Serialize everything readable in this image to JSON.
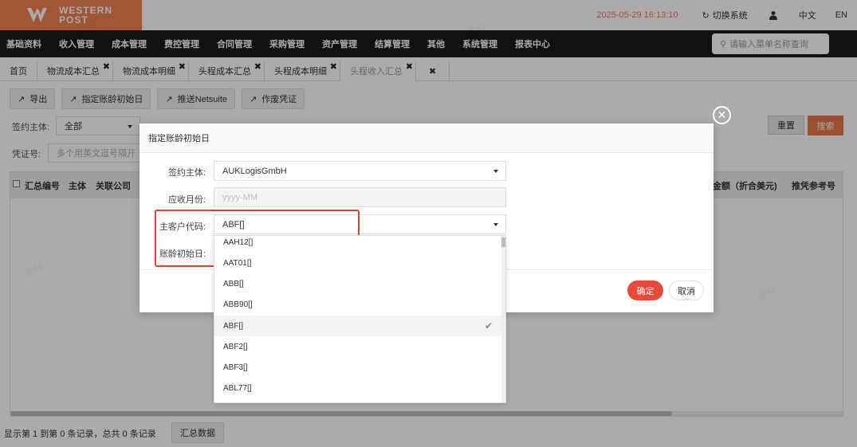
{
  "brand": {
    "logo_line1": "WESTERN",
    "logo_line2": "POST",
    "color": "#f08050"
  },
  "header": {
    "datetime": "2025-05-29 16:13:10",
    "switch_system": "切换系统",
    "lang_cn": "中文",
    "lang_en": "EN"
  },
  "nav": {
    "items": [
      "基础资料",
      "收入管理",
      "成本管理",
      "费控管理",
      "合同管理",
      "采购管理",
      "资产管理",
      "结算管理",
      "其他",
      "系统管理",
      "报表中心"
    ],
    "search_placeholder": "请输入菜单名称查询"
  },
  "tabs": [
    {
      "label": "首页",
      "closable": false
    },
    {
      "label": "物流成本汇总",
      "closable": true
    },
    {
      "label": "物流成本明细",
      "closable": true
    },
    {
      "label": "头程成本汇总",
      "closable": true
    },
    {
      "label": "头程成本明细",
      "closable": true
    },
    {
      "label": "头程收入汇总",
      "closable": true,
      "active": true
    }
  ],
  "toolbar": {
    "export": "导出",
    "set_aging": "指定账龄初始日",
    "push_netsuite": "推送Netsuite",
    "void_voucher": "作废凭证"
  },
  "filters": {
    "entity_label": "签约主体:",
    "entity_value": "全部",
    "voucher_label": "凭证号:",
    "voucher_placeholder": "多个用英文逗号隔开",
    "reset": "重置",
    "search": "搜索"
  },
  "table": {
    "headers_left": [
      "汇总编号",
      "主体",
      "关联公司"
    ],
    "headers_right": [
      "金额（折合美元)",
      "推凭参考号"
    ]
  },
  "footer": {
    "record_info": "显示第 1 到第 0 条记录，总共 0 条记录",
    "summary_button": "汇总数据"
  },
  "modal": {
    "title": "指定账龄初始日",
    "entity_label": "签约主体:",
    "entity_value": "AUKLogisGmbH",
    "month_label": "应收月份:",
    "month_placeholder": "yyyy-MM",
    "customer_label": "主客户代码:",
    "customer_value": "ABF[]",
    "aging_label": "账龄初始日:",
    "ok": "确定",
    "cancel": "取消"
  },
  "dropdown": {
    "options": [
      "AAH12[]",
      "AAT01[]",
      "ABB[]",
      "ABB90[]",
      "ABF[]",
      "ABF2[]",
      "ABF3[]",
      "ABL77[]"
    ],
    "selected": "ABF[]"
  },
  "watermark_text": "零刊"
}
